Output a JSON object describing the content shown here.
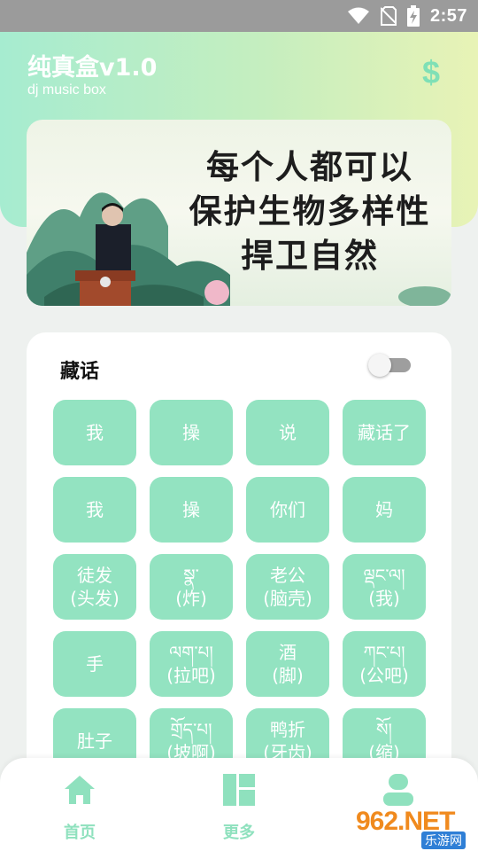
{
  "status_bar": {
    "time": "2:57",
    "icons": [
      "wifi-icon",
      "no-sim-icon",
      "battery-charging-icon"
    ]
  },
  "header": {
    "title": "纯真盒v1.0",
    "subtitle": "dj music box",
    "action_icon": "dollar-icon"
  },
  "banner": {
    "lines": [
      "每个人都可以",
      "保护生物多样性",
      "捍卫自然"
    ]
  },
  "panel": {
    "title": "藏话",
    "toggle_on": false,
    "buttons": [
      {
        "lines": [
          "我"
        ]
      },
      {
        "lines": [
          "操"
        ]
      },
      {
        "lines": [
          "说"
        ]
      },
      {
        "lines": [
          "藏话了"
        ]
      },
      {
        "lines": [
          "我"
        ]
      },
      {
        "lines": [
          "操"
        ]
      },
      {
        "lines": [
          "你们"
        ]
      },
      {
        "lines": [
          "妈"
        ]
      },
      {
        "lines": [
          "徒发",
          "(头发)"
        ]
      },
      {
        "lines": [
          "སྣ་",
          "(炸)"
        ]
      },
      {
        "lines": [
          "老公",
          "(脑壳)"
        ]
      },
      {
        "lines": [
          "ལྡང་ལ།",
          "(我)"
        ]
      },
      {
        "lines": [
          "手"
        ]
      },
      {
        "lines": [
          "ལག་པ།",
          "(拉吧)"
        ]
      },
      {
        "lines": [
          "酒",
          "(脚)"
        ]
      },
      {
        "lines": [
          "ཀང་པ།",
          "(公吧)"
        ]
      },
      {
        "lines": [
          "肚子"
        ]
      },
      {
        "lines": [
          "གྲོད་པ།",
          "(坡啊)"
        ]
      },
      {
        "lines": [
          "鸭折",
          "(牙齿)"
        ]
      },
      {
        "lines": [
          "སོ།",
          "(缩)"
        ]
      }
    ]
  },
  "bottom_nav": {
    "items": [
      {
        "label": "首页",
        "icon": "home-icon"
      },
      {
        "label": "更多",
        "icon": "grid-icon"
      },
      {
        "label": "",
        "icon": "user-icon"
      }
    ]
  },
  "watermark": {
    "main": "962.NET",
    "sub": "乐游网"
  },
  "colors": {
    "accent": "#93e3c1",
    "nav_label": "#8fe1be",
    "header_start": "#a6ecd0",
    "header_end": "#e8f3b6"
  }
}
